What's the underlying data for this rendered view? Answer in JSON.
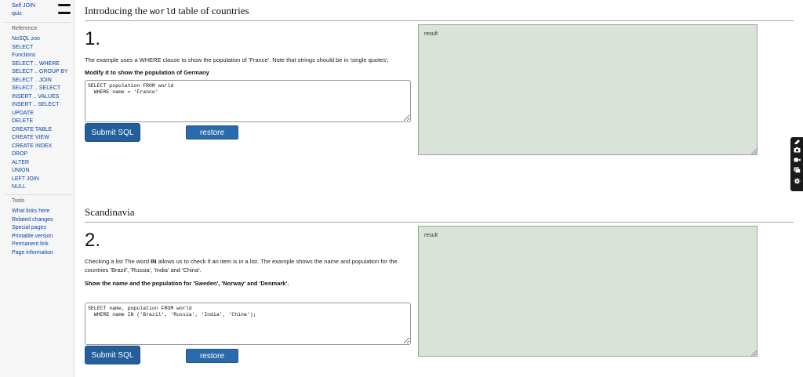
{
  "sidebar": {
    "top_links": [
      "Self JOIN",
      "quiz"
    ],
    "reference_heading": "Reference",
    "reference_links": [
      "NoSQL zoo",
      "SELECT",
      "Functions",
      "SELECT .. WHERE",
      "SELECT .. GROUP BY",
      "SELECT .. JOIN",
      "SELECT .. SELECT",
      "INSERT .. VALUES",
      "INSERT .. SELECT",
      "UPDATE",
      "DELETE",
      "CREATE TABLE",
      "CREATE VIEW",
      "CREATE INDEX",
      "DROP",
      "ALTER",
      "UNION",
      "LEFT JOIN",
      "NULL"
    ],
    "tools_heading": "Tools",
    "tools_links": [
      "What links here",
      "Related changes",
      "Special pages",
      "Printable version",
      "Permanent link",
      "Page information"
    ]
  },
  "section1": {
    "title_pre": "Introducing the",
    "title_code": "world",
    "title_post": "table of countries",
    "number": "1.",
    "description": "The example uses a WHERE clause to show the population of 'France'. Note that strings should be in 'single quotes';",
    "instruction": "Modify it to show the population of Germany",
    "sql": "SELECT population FROM world\n  WHERE name = 'France'",
    "submit_label": "Submit SQL",
    "restore_label": "restore default",
    "result_label": "result"
  },
  "section2": {
    "title": "Scandinavia",
    "number": "2.",
    "desc_part1": "Checking a list The word",
    "desc_keyword": "IN",
    "desc_part2": "allows us to check if an item is in a list. The example shows the name and population for the countries 'Brazil', 'Russia', 'India' and 'China'.",
    "instruction": "Show the name and the population for 'Sweden', 'Norway' and 'Denmark'.",
    "sql": "SELECT name, population FROM world\n  WHERE name IN ('Brazil', 'Russia', 'India', 'China');",
    "submit_label": "Submit SQL",
    "restore_label": "restore default",
    "result_label": "result"
  },
  "toolbar": {
    "icons": [
      "pencil-icon",
      "camera-icon",
      "video-icon",
      "slides-icon",
      "gear-icon"
    ]
  }
}
